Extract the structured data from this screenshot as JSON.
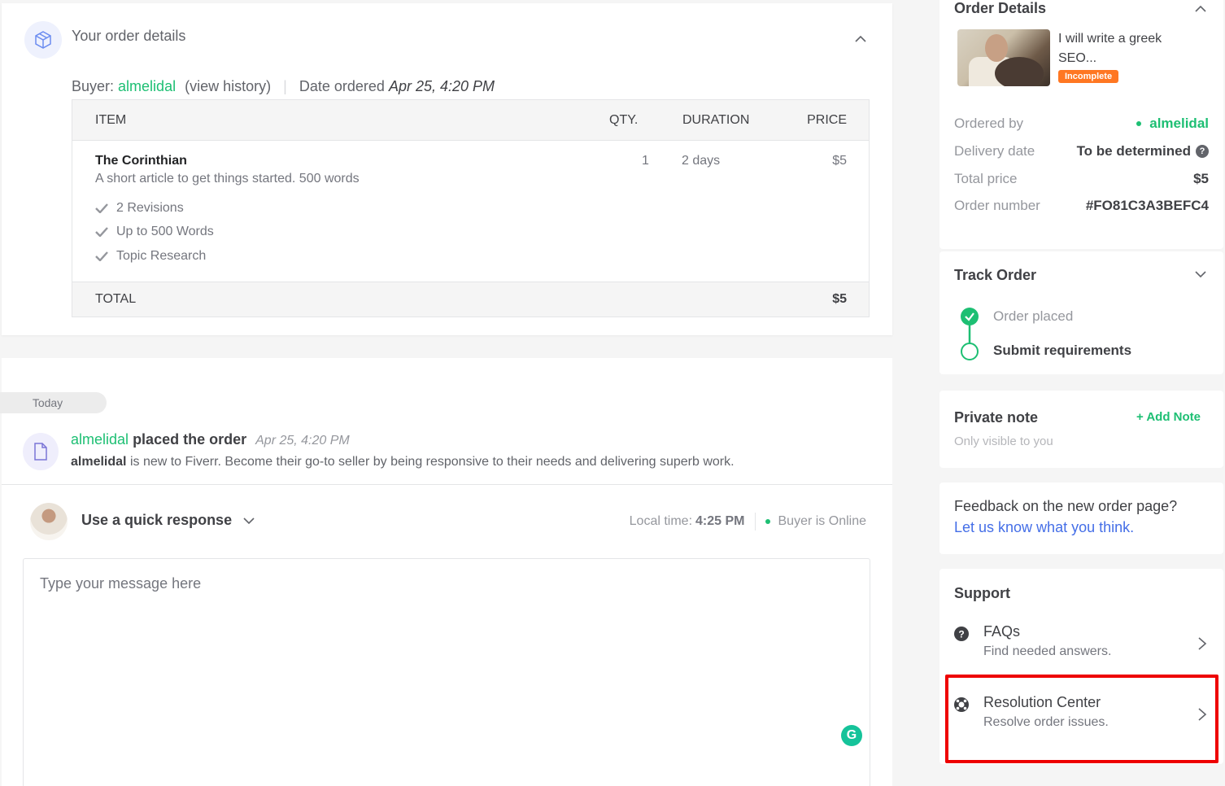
{
  "order_details": {
    "title": "Your order details",
    "buyer_label": "Buyer:",
    "buyer_name": "almelidal",
    "view_history": "(view history)",
    "date_label": "Date ordered",
    "date_value": "Apr 25, 4:20 PM",
    "table": {
      "headers": [
        "ITEM",
        "QTY.",
        "DURATION",
        "PRICE"
      ],
      "item": {
        "name": "The Corinthian",
        "description": "A short article to get things started. 500 words",
        "qty": "1",
        "duration": "2 days",
        "price": "$5",
        "features": [
          "2 Revisions",
          "Up to 500 Words",
          "Topic Research"
        ]
      },
      "total_label": "TOTAL",
      "total_value": "$5"
    }
  },
  "activity": {
    "day_label": "Today",
    "event": {
      "user": "almelidal",
      "action": "placed the order",
      "time": "Apr 25, 4:20 PM",
      "sub_user": "almelidal",
      "sub_text": "is new to Fiverr. Become their go-to seller by being responsive to their needs and delivering superb work."
    },
    "quick_response": "Use a quick response",
    "local_time_label": "Local time:",
    "local_time_value": "4:25 PM",
    "buyer_status": "Buyer is Online",
    "message_placeholder": "Type your message here",
    "grammarly_letter": "G"
  },
  "sidebar": {
    "details": {
      "title": "Order Details",
      "gig_title": "I will write a greek SEO...",
      "status_badge": "Incomplete",
      "rows": [
        {
          "label": "Ordered by",
          "value": "almelidal"
        },
        {
          "label": "Delivery date",
          "value": "To be determined"
        },
        {
          "label": "Total price",
          "value": "$5"
        },
        {
          "label": "Order number",
          "value": "#FO81C3A3BEFC4"
        }
      ]
    },
    "track": {
      "title": "Track Order",
      "steps": [
        {
          "label": "Order placed",
          "status": "done"
        },
        {
          "label": "Submit requirements",
          "status": "current"
        }
      ]
    },
    "note": {
      "title": "Private note",
      "add_label": "+ Add Note",
      "subtitle": "Only visible to you"
    },
    "feedback": {
      "title": "Feedback on the new order page?",
      "link": "Let us know what you think."
    },
    "support": {
      "title": "Support",
      "items": [
        {
          "title": "FAQs",
          "subtitle": "Find needed answers."
        },
        {
          "title": "Resolution Center",
          "subtitle": "Resolve order issues."
        }
      ]
    }
  },
  "colors": {
    "accent_green": "#1dbf73",
    "link_blue": "#446ee7",
    "badge_orange": "#ff7722",
    "highlight_red": "#ee0000"
  }
}
